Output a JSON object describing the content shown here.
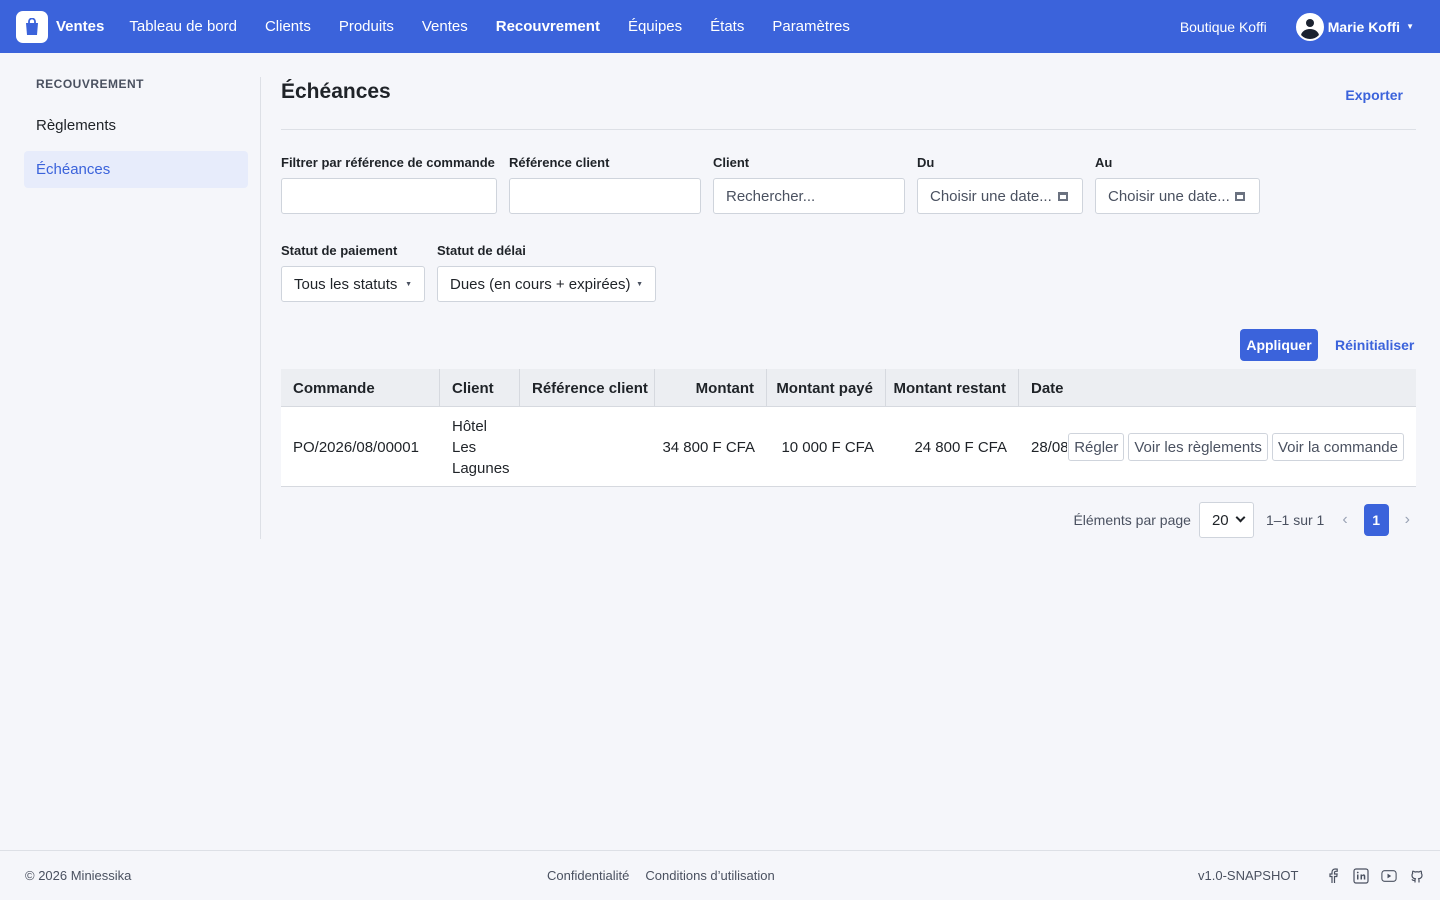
{
  "brand": {
    "name": "Ventes"
  },
  "nav": {
    "links": [
      "Tableau de bord",
      "Clients",
      "Produits",
      "Ventes",
      "Recouvrement",
      "Équipes",
      "États",
      "Paramètres"
    ],
    "active": "Recouvrement"
  },
  "header_right": {
    "store": "Boutique Koffi",
    "user": "Marie Koffi"
  },
  "sidebar": {
    "title": "RECOUVREMENT",
    "items": [
      {
        "label": "Règlements"
      },
      {
        "label": "Échéances"
      }
    ],
    "active": "Échéances"
  },
  "page": {
    "title": "Échéances",
    "export_label": "Exporter"
  },
  "filters": {
    "order_ref": {
      "label": "Filtrer par référence de commande",
      "value": ""
    },
    "client_ref": {
      "label": "Référence client",
      "value": ""
    },
    "client": {
      "label": "Client",
      "placeholder": "Rechercher..."
    },
    "date_from": {
      "label": "Du",
      "placeholder": "Choisir une date..."
    },
    "date_to": {
      "label": "Au",
      "placeholder": "Choisir une date..."
    },
    "payment_status": {
      "label": "Statut de paiement",
      "value": "Tous les statuts"
    },
    "delay_status": {
      "label": "Statut de délai",
      "value": "Dues (en cours + expirées)"
    },
    "apply_label": "Appliquer",
    "reset_label": "Réinitialiser"
  },
  "table": {
    "columns": [
      "Commande",
      "Client",
      "Référence client",
      "Montant",
      "Montant payé",
      "Montant restant",
      "Date "
    ],
    "rows": [
      {
        "order": "PO/2026/08/00001",
        "client": "Hôtel Les Lagunes",
        "client_ref": "",
        "amount": "34 800 F CFA",
        "paid": "10 000 F CFA",
        "remaining": "24 800 F CFA",
        "date": "28/08",
        "actions": [
          "Régler",
          "Voir les règlements",
          "Voir la commande"
        ]
      }
    ]
  },
  "pagination": {
    "per_page_label": "Éléments par page",
    "per_page": "20",
    "range": "1–1 sur 1",
    "current_page": "1",
    "prev": "‹",
    "next": "›"
  },
  "footer": {
    "copyright": "© 2026 Miniessika",
    "links": [
      "Confidentialité",
      "Conditions d’utilisation"
    ],
    "version": "v1.0-SNAPSHOT",
    "socials": [
      "facebook-icon",
      "linkedin-icon",
      "youtube-icon",
      "github-icon"
    ]
  },
  "colors": {
    "primary": "#3b63db",
    "background": "#f5f6fa"
  }
}
